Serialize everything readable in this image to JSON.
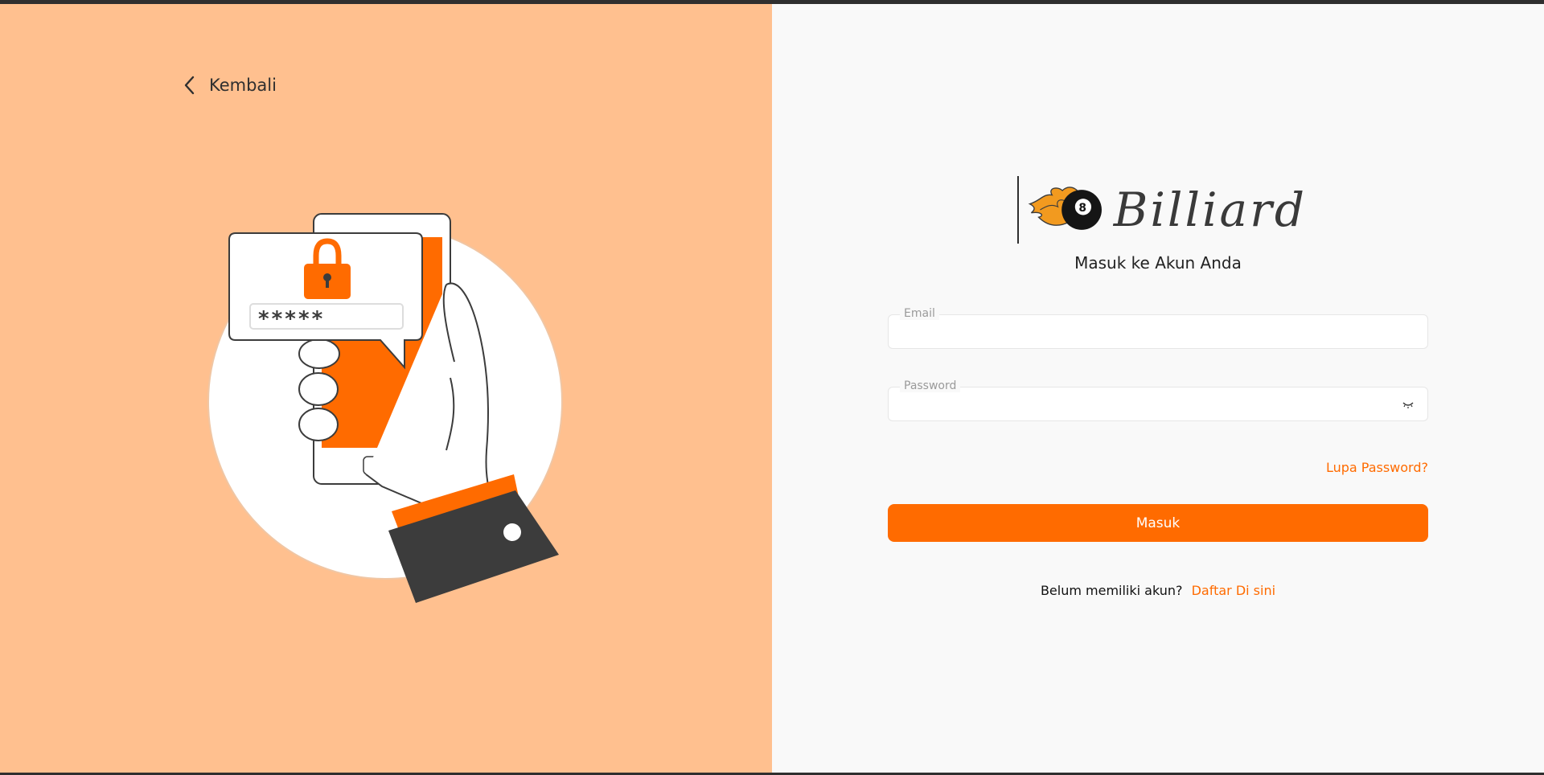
{
  "nav": {
    "back_label": "Kembali"
  },
  "brand": {
    "name": "Billiard"
  },
  "login": {
    "heading": "Masuk ke Akun Anda",
    "email_label": "Email",
    "email_value": "",
    "password_label": "Password",
    "password_value": "",
    "forgot_label": "Lupa Password?",
    "submit_label": "Masuk",
    "register_prompt": "Belum memiliki akun?",
    "register_link": "Daftar Di sini"
  },
  "illustration": {
    "masked_password": "*****"
  },
  "colors": {
    "accent": "#ff6b00",
    "left_background": "#ffc08f",
    "right_background": "#f9f9f9",
    "dark": "#3c3c3c"
  },
  "icons": {
    "back": "chevron-left-icon",
    "lock": "padlock-icon",
    "eye": "eye-closed-icon",
    "logo": "flaming-8-ball-icon"
  }
}
